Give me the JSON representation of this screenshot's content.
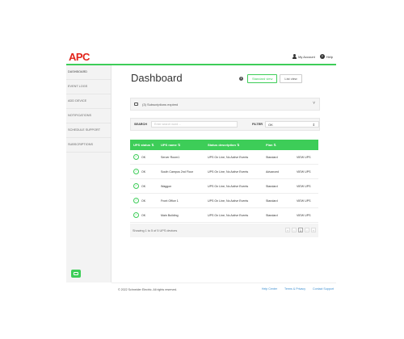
{
  "header": {
    "logo": "APC",
    "my_account": "My Account",
    "help": "Help"
  },
  "sidebar": {
    "items": [
      {
        "label": "DASHBOARD"
      },
      {
        "label": "EVENT LOGS"
      },
      {
        "label": "ADD DEVICE"
      },
      {
        "label": "NOTIFICATIONS"
      },
      {
        "label": "SCHEDULE SUPPORT"
      },
      {
        "label": "SUBSCRIPTIONS"
      }
    ]
  },
  "main": {
    "title": "Dashboard",
    "view_toggle": {
      "info": "i",
      "standard": "Standard view",
      "list": "List view"
    },
    "alert": {
      "text": "(3) Subscriptions expired",
      "chevron": "˅"
    },
    "toolbar": {
      "search_label": "SEARCH",
      "search_placeholder": "Enter search word ...",
      "filter_label": "FILTER",
      "filter_value": "OK",
      "filter_caret": "⇕"
    },
    "table": {
      "headers": [
        "UPS status ⇅",
        "UPS name ⇅",
        "Status description ⇅",
        "Plan ⇅",
        ""
      ],
      "rows": [
        {
          "status": "OK",
          "name": "Server Room1",
          "description": "UPS On Line, No Active Events",
          "plan": "Standard",
          "action": "VIEW UPS"
        },
        {
          "status": "OK",
          "name": "South Campus 2nd Floor",
          "description": "UPS On Line, No Active Events",
          "plan": "Advanced",
          "action": "VIEW UPS"
        },
        {
          "status": "OK",
          "name": "Waggon",
          "description": "UPS On Line, No Active Events",
          "plan": "Standard",
          "action": "VIEW UPS"
        },
        {
          "status": "OK",
          "name": "Front Office 1",
          "description": "UPS On Line, No Active Events",
          "plan": "Standard",
          "action": "VIEW UPS"
        },
        {
          "status": "OK",
          "name": "Main Building",
          "description": "UPS On Line, No Active Events",
          "plan": "Standard",
          "action": "VIEW UPS"
        }
      ],
      "footer": {
        "showing": "Showing 1 to 5 of 5 UPS devices",
        "pages": [
          "«",
          "‹",
          "1",
          "›",
          "»"
        ],
        "current_page": "1"
      }
    }
  },
  "footer": {
    "copyright": "© 2022 Schneider Electric. All rights reserved.",
    "links": [
      "Help Center",
      "Terms & Privacy",
      "Contact Support"
    ]
  },
  "colors": {
    "brand_green": "#3dcd58",
    "logo_red": "#e2231a"
  }
}
